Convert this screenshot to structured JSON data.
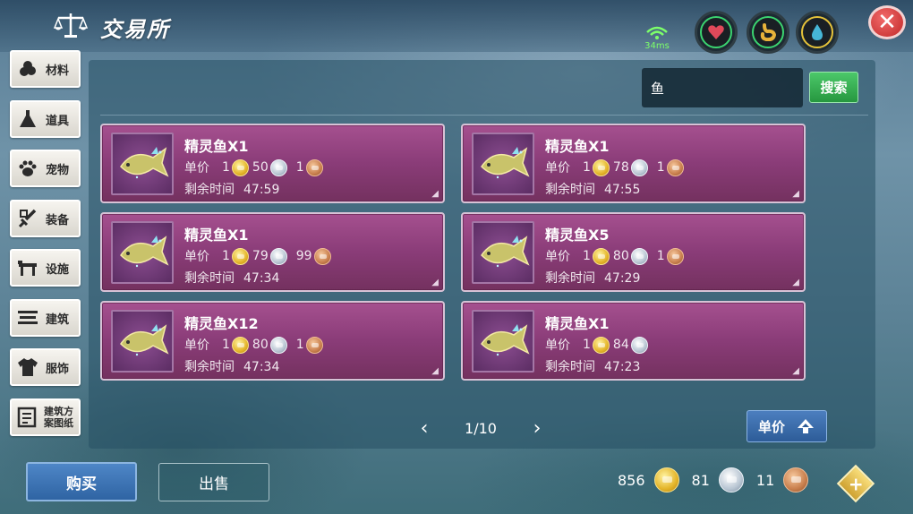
{
  "header": {
    "title": "交易所",
    "ping": "34ms"
  },
  "sidebar": {
    "items": [
      {
        "label": "材料",
        "icon": "materials-icon"
      },
      {
        "label": "道具",
        "icon": "flask-icon"
      },
      {
        "label": "宠物",
        "icon": "paw-icon"
      },
      {
        "label": "装备",
        "icon": "sword-icon"
      },
      {
        "label": "设施",
        "icon": "facility-icon"
      },
      {
        "label": "建筑",
        "icon": "building-icon"
      },
      {
        "label": "服饰",
        "icon": "shirt-icon"
      },
      {
        "label": "建筑方案图纸",
        "icon": "blueprint-icon"
      }
    ]
  },
  "search": {
    "value": "鱼",
    "button_label": "搜索"
  },
  "labels": {
    "price": "单价",
    "time_left": "剩余时间"
  },
  "listings": [
    {
      "name": "精灵鱼X1",
      "gold": "1",
      "silver": "50",
      "copper": "1",
      "time": "47:59"
    },
    {
      "name": "精灵鱼X1",
      "gold": "1",
      "silver": "78",
      "copper": "1",
      "time": "47:55"
    },
    {
      "name": "精灵鱼X1",
      "gold": "1",
      "silver": "79",
      "copper": "99",
      "time": "47:34"
    },
    {
      "name": "精灵鱼X5",
      "gold": "1",
      "silver": "80",
      "copper": "1",
      "time": "47:29"
    },
    {
      "name": "精灵鱼X12",
      "gold": "1",
      "silver": "80",
      "copper": "1",
      "time": "47:34"
    },
    {
      "name": "精灵鱼X1",
      "gold": "1",
      "silver": "84",
      "copper": "",
      "time": "47:23"
    }
  ],
  "pager": {
    "page": "1/10",
    "prev": "‹",
    "next": "›"
  },
  "sort": {
    "label": "单价"
  },
  "footer": {
    "buy_label": "购买",
    "sell_label": "出售",
    "wallet": {
      "gold": "856",
      "silver": "81",
      "copper": "11"
    },
    "add_symbol": "+"
  },
  "colors": {
    "card": "#8a3c78",
    "search_button": "#26973f",
    "buy_button": "#2f64a3",
    "close_button": "#c02828"
  }
}
